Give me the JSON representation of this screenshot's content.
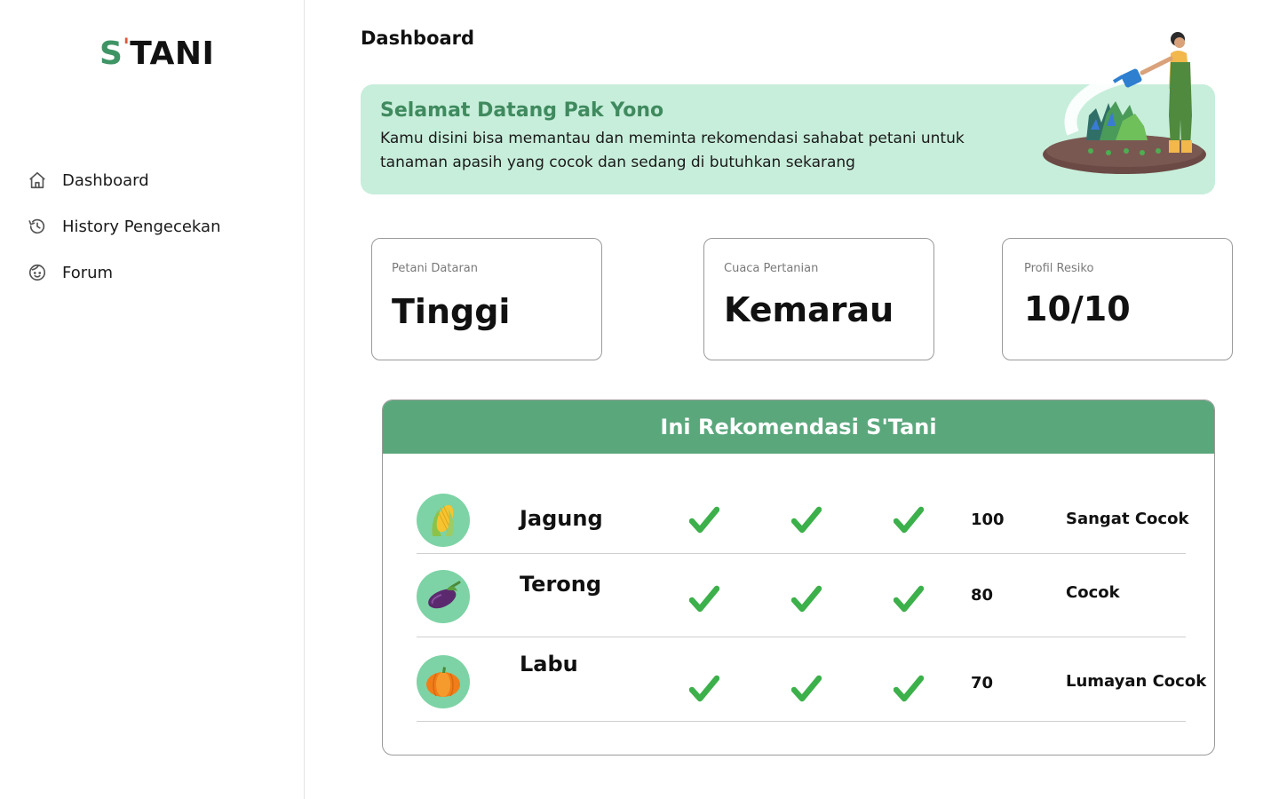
{
  "brand": {
    "s": "S",
    "apos": "'",
    "rest": "TANI"
  },
  "sidebar": {
    "items": [
      {
        "label": "Dashboard",
        "icon": "home-icon"
      },
      {
        "label": "History Pengecekan",
        "icon": "history-icon"
      },
      {
        "label": "Forum",
        "icon": "face-icon"
      }
    ]
  },
  "header": {
    "title": "Dashboard"
  },
  "welcome": {
    "title": "Selamat Datang Pak Yono",
    "text": "Kamu disini bisa memantau dan meminta rekomendasi sahabat petani untuk tanaman apasih yang cocok dan sedang di butuhkan sekarang"
  },
  "stats": [
    {
      "label": "Petani Dataran",
      "value": "Tinggi"
    },
    {
      "label": "Cuaca Pertanian",
      "value": "Kemarau"
    },
    {
      "label": "Profil Resiko",
      "value": "10/10"
    }
  ],
  "recommendation": {
    "title": "Ini Rekomendasi S'Tani",
    "rows": [
      {
        "name": "Jagung",
        "icon": "corn-icon",
        "checks": [
          true,
          true,
          true
        ],
        "score": "100",
        "verdict": "Sangat Cocok"
      },
      {
        "name": "Terong",
        "icon": "eggplant-icon",
        "checks": [
          true,
          true,
          true
        ],
        "score": "80",
        "verdict": "Cocok"
      },
      {
        "name": "Labu",
        "icon": "pumpkin-icon",
        "checks": [
          true,
          true,
          true
        ],
        "score": "70",
        "verdict": "Lumayan Cocok"
      }
    ]
  },
  "colors": {
    "brand_green": "#3f9466",
    "accent_red": "#e0573b",
    "banner_bg": "#c7eedb",
    "table_header": "#5aa77c",
    "avatar_bg": "#7dd3a5",
    "check_green": "#3cb04a"
  }
}
